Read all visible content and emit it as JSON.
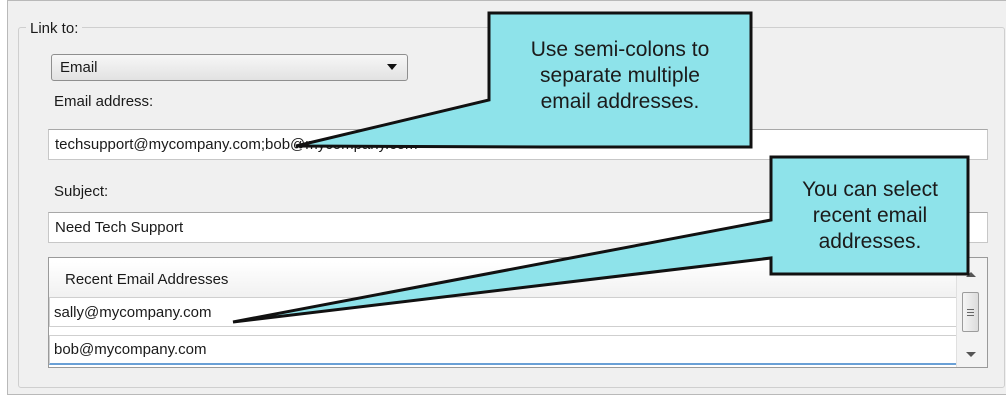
{
  "groupbox": {
    "legend": "Link to:"
  },
  "link_type": {
    "selected": "Email"
  },
  "email": {
    "label": "Email address:",
    "value": "techsupport@mycompany.com;bob@mycompany.com"
  },
  "subject": {
    "label": "Subject:",
    "value": "Need Tech Support"
  },
  "recent_list": {
    "header": "Recent Email Addresses",
    "items": [
      "sally@mycompany.com",
      "bob@mycompany.com"
    ]
  },
  "callouts": [
    {
      "lines": [
        "Use semi-colons to",
        "separate multiple",
        "email addresses."
      ]
    },
    {
      "lines": [
        "You can select",
        "recent email",
        "addresses."
      ]
    }
  ],
  "colors": {
    "callout_fill": "#8ee3ea",
    "callout_border": "#111111",
    "panel_bg": "#f0f0f0",
    "selection_line": "#6aa0d6"
  },
  "icons": {
    "combo": "chevron-down-icon",
    "scroll_up": "scroll-up-icon",
    "scroll_down": "scroll-down-icon",
    "scroll_thumb": "scroll-thumb-grip-icon"
  }
}
